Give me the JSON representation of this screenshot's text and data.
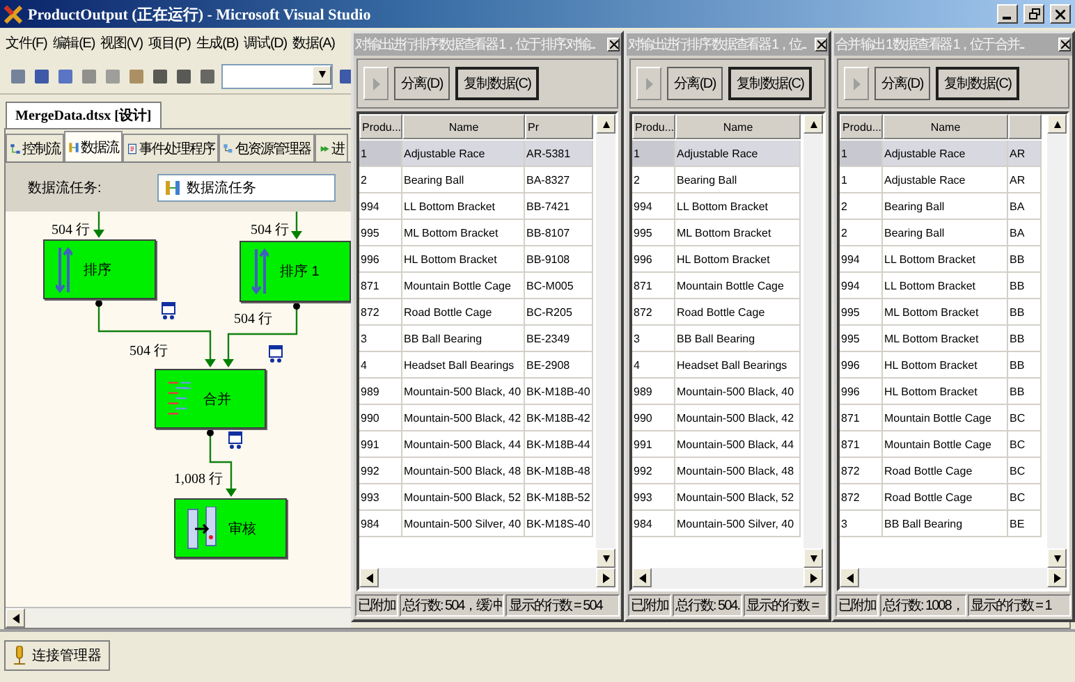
{
  "window": {
    "title": "ProductOutput (正在运行) - Microsoft Visual Studio"
  },
  "menu": [
    "文件(F)",
    "编辑(E)",
    "视图(V)",
    "项目(P)",
    "生成(B)",
    "调试(D)",
    "数据(A)"
  ],
  "document_tab": "MergeData.dtsx [设计]",
  "designer_tabs": [
    {
      "label": "控制流",
      "selected": false
    },
    {
      "label": "数据流",
      "selected": true
    },
    {
      "label": "事件处理程序",
      "selected": false
    },
    {
      "label": "包资源管理器",
      "selected": false
    },
    {
      "label": "进",
      "selected": false
    }
  ],
  "task": {
    "label": "数据流任务:",
    "value": "数据流任务"
  },
  "diagram": {
    "nodes": [
      {
        "label": "排序",
        "kind": "sort"
      },
      {
        "label": "排序 1",
        "kind": "sort"
      },
      {
        "label": "合并",
        "kind": "merge"
      },
      {
        "label": "审核",
        "kind": "audit"
      }
    ],
    "path_labels": [
      "504 行",
      "504 行",
      "504 行",
      "504 行",
      "1,008 行"
    ]
  },
  "connection_tab": "连接管理器",
  "viewers": [
    {
      "title": "对输出进行排序 数据查看器 1，位于 排序.对输...",
      "buttons": [
        "分离(D)",
        "复制数据(C)"
      ],
      "columns": [
        "Produ...",
        "Name",
        "Pr"
      ],
      "rows": [
        {
          "cells": [
            "1",
            "Adjustable Race",
            "AR-5381"
          ],
          "selected": true
        },
        {
          "cells": [
            "2",
            "Bearing Ball",
            "BA-8327"
          ],
          "selected": false
        },
        {
          "cells": [
            "994",
            "LL Bottom Bracket",
            "BB-7421"
          ],
          "selected": false
        },
        {
          "cells": [
            "995",
            "ML Bottom Bracket",
            "BB-8107"
          ],
          "selected": false
        },
        {
          "cells": [
            "996",
            "HL Bottom Bracket",
            "BB-9108"
          ],
          "selected": false
        },
        {
          "cells": [
            "871",
            "Mountain Bottle Cage",
            "BC-M005"
          ],
          "selected": false
        },
        {
          "cells": [
            "872",
            "Road Bottle Cage",
            "BC-R205"
          ],
          "selected": false
        },
        {
          "cells": [
            "3",
            "BB Ball Bearing",
            "BE-2349"
          ],
          "selected": false
        },
        {
          "cells": [
            "4",
            "Headset Ball Bearings",
            "BE-2908"
          ],
          "selected": false
        },
        {
          "cells": [
            "989",
            "Mountain-500 Black, 40",
            "BK-M18B-40"
          ],
          "selected": false
        },
        {
          "cells": [
            "990",
            "Mountain-500 Black, 42",
            "BK-M18B-42"
          ],
          "selected": false
        },
        {
          "cells": [
            "991",
            "Mountain-500 Black, 44",
            "BK-M18B-44"
          ],
          "selected": false
        },
        {
          "cells": [
            "992",
            "Mountain-500 Black, 48",
            "BK-M18B-48"
          ],
          "selected": false
        },
        {
          "cells": [
            "993",
            "Mountain-500 Black, 52",
            "BK-M18B-52"
          ],
          "selected": false
        },
        {
          "cells": [
            "984",
            "Mountain-500 Silver, 40",
            "BK-M18S-40"
          ],
          "selected": false
        }
      ],
      "status": [
        "已附加",
        "总行数: 504，缓冲",
        "显示的行数 = 504"
      ]
    },
    {
      "title": "对输出进行排序 数据查看器 1，位...",
      "buttons": [
        "分离(D)",
        "复制数据(C)"
      ],
      "columns": [
        "Produ...",
        "Name"
      ],
      "rows": [
        {
          "cells": [
            "1",
            "Adjustable Race"
          ],
          "selected": true
        },
        {
          "cells": [
            "2",
            "Bearing Ball"
          ],
          "selected": false
        },
        {
          "cells": [
            "994",
            "LL Bottom Bracket"
          ],
          "selected": false
        },
        {
          "cells": [
            "995",
            "ML Bottom Bracket"
          ],
          "selected": false
        },
        {
          "cells": [
            "996",
            "HL Bottom Bracket"
          ],
          "selected": false
        },
        {
          "cells": [
            "871",
            "Mountain Bottle Cage"
          ],
          "selected": false
        },
        {
          "cells": [
            "872",
            "Road Bottle Cage"
          ],
          "selected": false
        },
        {
          "cells": [
            "3",
            "BB Ball Bearing"
          ],
          "selected": false
        },
        {
          "cells": [
            "4",
            "Headset Ball Bearings"
          ],
          "selected": false
        },
        {
          "cells": [
            "989",
            "Mountain-500 Black, 40"
          ],
          "selected": false
        },
        {
          "cells": [
            "990",
            "Mountain-500 Black, 42"
          ],
          "selected": false
        },
        {
          "cells": [
            "991",
            "Mountain-500 Black, 44"
          ],
          "selected": false
        },
        {
          "cells": [
            "992",
            "Mountain-500 Black, 48"
          ],
          "selected": false
        },
        {
          "cells": [
            "993",
            "Mountain-500 Black, 52"
          ],
          "selected": false
        },
        {
          "cells": [
            "984",
            "Mountain-500 Silver, 40"
          ],
          "selected": false
        }
      ],
      "status": [
        "已附加",
        "总行数: 504.",
        "显示的行数 ="
      ]
    },
    {
      "title": "合并 输出 1 数据查看器 1，位于 合并...",
      "buttons": [
        "分离(D)",
        "复制数据(C)"
      ],
      "columns": [
        "Produ...",
        "Name"
      ],
      "rows": [
        {
          "cells": [
            "1",
            "Adjustable Race",
            "AR"
          ],
          "selected": true
        },
        {
          "cells": [
            "1",
            "Adjustable Race",
            "AR"
          ],
          "selected": false
        },
        {
          "cells": [
            "2",
            "Bearing Ball",
            "BA"
          ],
          "selected": false
        },
        {
          "cells": [
            "2",
            "Bearing Ball",
            "BA"
          ],
          "selected": false
        },
        {
          "cells": [
            "994",
            "LL Bottom Bracket",
            "BB"
          ],
          "selected": false
        },
        {
          "cells": [
            "994",
            "LL Bottom Bracket",
            "BB"
          ],
          "selected": false
        },
        {
          "cells": [
            "995",
            "ML Bottom Bracket",
            "BB"
          ],
          "selected": false
        },
        {
          "cells": [
            "995",
            "ML Bottom Bracket",
            "BB"
          ],
          "selected": false
        },
        {
          "cells": [
            "996",
            "HL Bottom Bracket",
            "BB"
          ],
          "selected": false
        },
        {
          "cells": [
            "996",
            "HL Bottom Bracket",
            "BB"
          ],
          "selected": false
        },
        {
          "cells": [
            "871",
            "Mountain Bottle Cage",
            "BC"
          ],
          "selected": false
        },
        {
          "cells": [
            "871",
            "Mountain Bottle Cage",
            "BC"
          ],
          "selected": false
        },
        {
          "cells": [
            "872",
            "Road Bottle Cage",
            "BC"
          ],
          "selected": false
        },
        {
          "cells": [
            "872",
            "Road Bottle Cage",
            "BC"
          ],
          "selected": false
        },
        {
          "cells": [
            "3",
            "BB Ball Bearing",
            "BE"
          ],
          "selected": false
        }
      ],
      "status": [
        "已附加",
        "总行数: 1008，",
        "显示的行数 = 1"
      ]
    }
  ]
}
